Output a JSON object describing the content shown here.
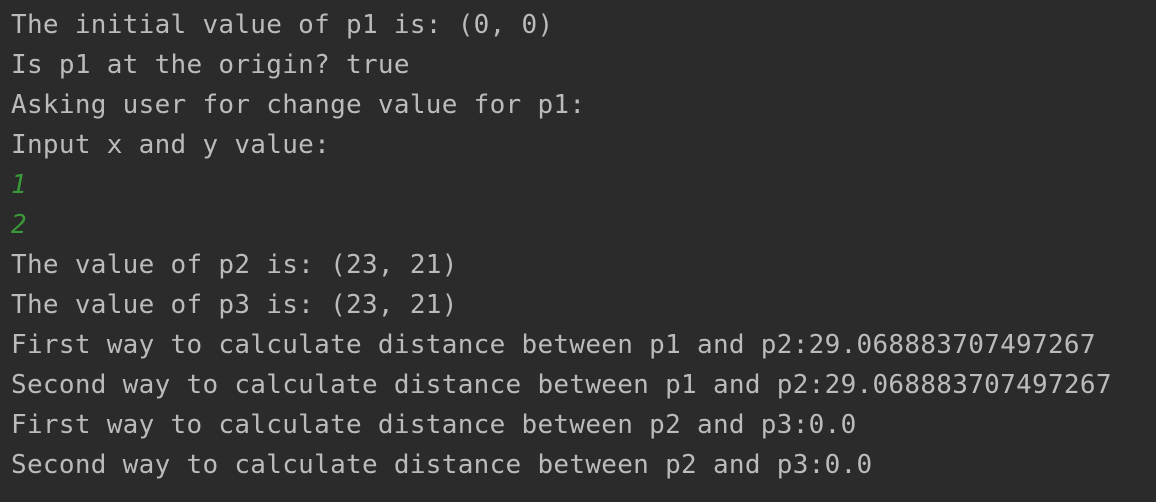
{
  "console": {
    "lines": [
      {
        "text": "The initial value of p1 is: (0, 0)",
        "kind": "output"
      },
      {
        "text": "Is p1 at the origin? true",
        "kind": "output"
      },
      {
        "text": "Asking user for change value for p1:",
        "kind": "output"
      },
      {
        "text": "Input x and y value:",
        "kind": "output"
      },
      {
        "text": "1",
        "kind": "user-input"
      },
      {
        "text": "2",
        "kind": "user-input"
      },
      {
        "text": "The value of p2 is: (23, 21)",
        "kind": "output"
      },
      {
        "text": "The value of p3 is: (23, 21)",
        "kind": "output"
      },
      {
        "text": "First way to calculate distance between p1 and p2:29.068883707497267",
        "kind": "output"
      },
      {
        "text": "Second way to calculate distance between p1 and p2:29.068883707497267",
        "kind": "output"
      },
      {
        "text": "First way to calculate distance between p2 and p3:0.0",
        "kind": "output"
      },
      {
        "text": "Second way to calculate distance between p2 and p3:0.0",
        "kind": "output"
      }
    ]
  },
  "colors": {
    "background": "#2b2b2b",
    "output_text": "#bbbbbb",
    "user_input_text": "#3a9a3a"
  }
}
